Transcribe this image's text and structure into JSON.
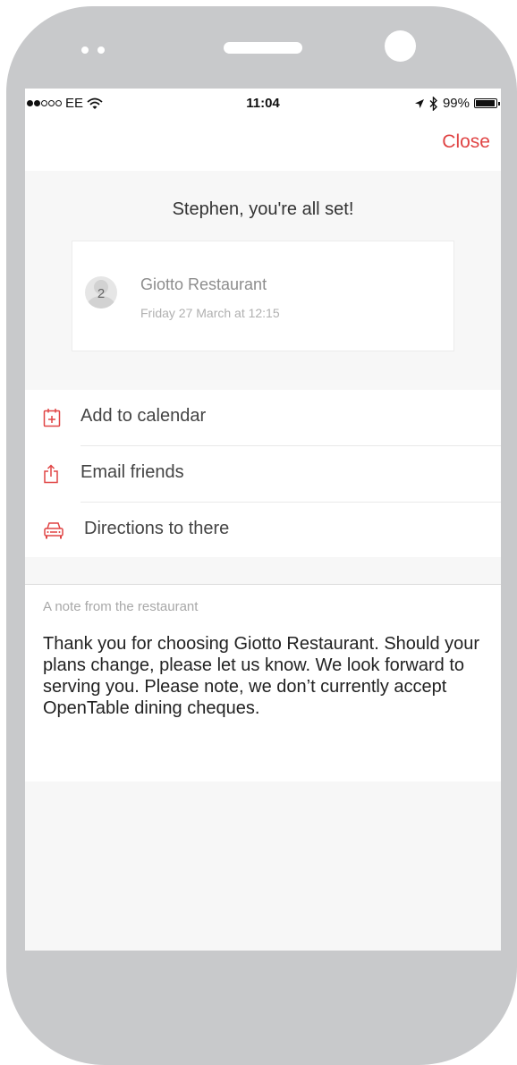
{
  "statusbar": {
    "carrier": "EE",
    "time": "11:04",
    "battery": "99%"
  },
  "navbar": {
    "close_label": "Close"
  },
  "confirmation": {
    "title": "Stephen, you're all set!",
    "party_size": "2",
    "restaurant_name": "Giotto Restaurant",
    "datetime": "Friday 27 March at 12:15"
  },
  "actions": [
    {
      "label": "Add to calendar",
      "icon": "calendar-add-icon"
    },
    {
      "label": "Email friends",
      "icon": "share-icon"
    },
    {
      "label": "Directions to there",
      "icon": "car-icon"
    }
  ],
  "note": {
    "title": "A note from the restaurant",
    "body": "Thank you for choosing Giotto Restaurant. Should your plans change, please let us know. We look forward to serving you. Please note, we don’t currently accept OpenTable dining cheques."
  },
  "colors": {
    "accent": "#e04545",
    "frame": "#c8c9cb"
  }
}
